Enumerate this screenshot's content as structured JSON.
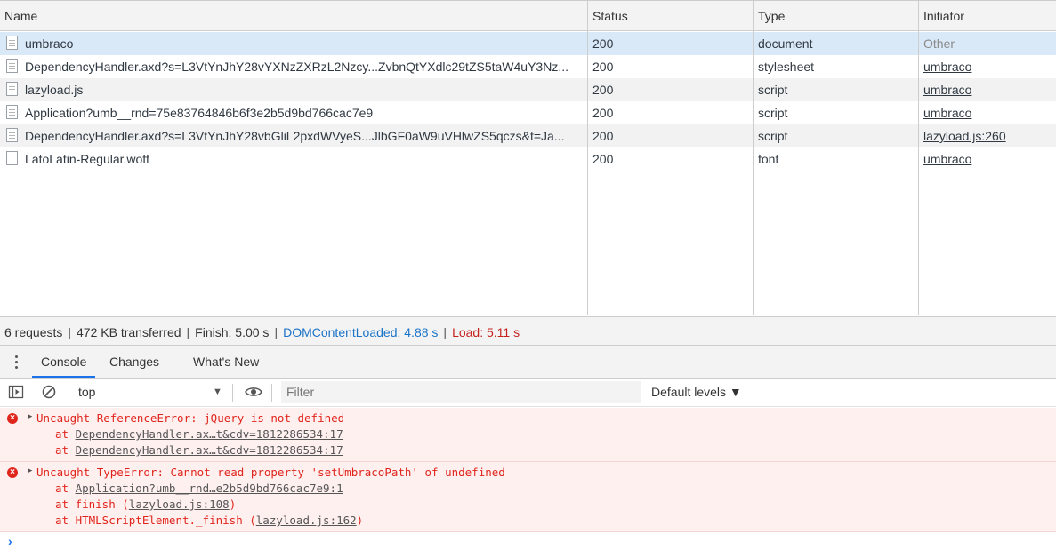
{
  "network": {
    "columns": {
      "name": "Name",
      "status": "Status",
      "type": "Type",
      "initiator": "Initiator"
    },
    "rows": [
      {
        "name": "umbraco",
        "status": "200",
        "type": "document",
        "initiator": "Other"
      },
      {
        "name": "DependencyHandler.axd?s=L3VtYnJhY28vYXNzZXRzL2Nzcy...ZvbnQtYXdlc29tZS5taW4uY3Nz...",
        "status": "200",
        "type": "stylesheet",
        "initiator": "umbraco"
      },
      {
        "name": "lazyload.js",
        "status": "200",
        "type": "script",
        "initiator": "umbraco"
      },
      {
        "name": "Application?umb__rnd=75e83764846b6f3e2b5d9bd766cac7e9",
        "status": "200",
        "type": "script",
        "initiator": "umbraco"
      },
      {
        "name": "DependencyHandler.axd?s=L3VtYnJhY28vbGliL2pxdWVyeS...JlbGF0aW9uVHlwZS5qczs&t=Ja...",
        "status": "200",
        "type": "script",
        "initiator": "lazyload.js:260"
      },
      {
        "name": "LatoLatin-Regular.woff",
        "status": "200",
        "type": "font",
        "initiator": "umbraco"
      }
    ]
  },
  "summary": {
    "requests": "6 requests",
    "transferred": "472 KB transferred",
    "finish": "Finish: 5.00 s",
    "dcl": "DOMContentLoaded: 4.88 s",
    "load": "Load: 5.11 s",
    "separator": "|"
  },
  "drawer": {
    "tabs": [
      "Console",
      "Changes",
      "What's New"
    ]
  },
  "console_toolbar": {
    "context": "top",
    "filter_placeholder": "Filter",
    "levels": "Default levels ▼"
  },
  "errors": [
    {
      "message": "Uncaught ReferenceError: jQuery is not defined",
      "stack": [
        {
          "prefix": "at ",
          "link": "DependencyHandler.ax…t&cdv=1812286534:17",
          "suffix": ""
        },
        {
          "prefix": "at ",
          "link": "DependencyHandler.ax…t&cdv=1812286534:17",
          "suffix": ""
        }
      ]
    },
    {
      "message": "Uncaught TypeError: Cannot read property 'setUmbracoPath' of undefined",
      "stack": [
        {
          "prefix": "at ",
          "link": "Application?umb__rnd…e2b5d9bd766cac7e9:1",
          "suffix": ""
        },
        {
          "prefix": "at finish (",
          "link": "lazyload.js:108",
          "suffix": ")"
        },
        {
          "prefix": "at HTMLScriptElement._finish (",
          "link": "lazyload.js:162",
          "suffix": ")"
        }
      ]
    }
  ],
  "colors": {
    "selected_row": "#dae9f8",
    "stripe_row": "#f2f2f2",
    "dcl": "#1a73c8",
    "load": "#c5221f",
    "error_text": "#e0251c",
    "error_bg": "#fff0f0"
  },
  "icons": [
    "document-icon",
    "kebab-menu-icon",
    "sidebar-toggle-icon",
    "clear-console-icon",
    "eye-icon",
    "error-icon",
    "expand-triangle-icon",
    "prompt-icon"
  ]
}
